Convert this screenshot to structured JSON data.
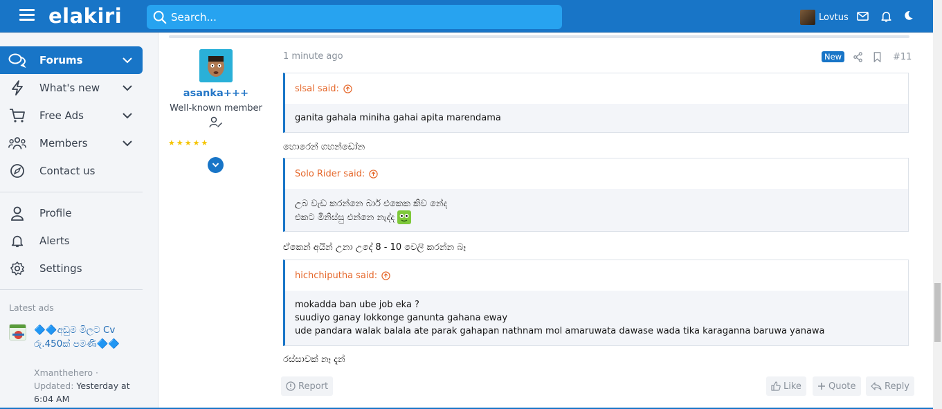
{
  "header": {
    "logo": "elakiri",
    "search_placeholder": "Search...",
    "username": "Lovtus",
    "brand_color": "#1875c7"
  },
  "sidebar": {
    "items": [
      {
        "label": "Forums",
        "icon": "chat-bubbles-icon",
        "active": true
      },
      {
        "label": "What's new",
        "icon": "lightning-icon"
      },
      {
        "label": "Free Ads",
        "icon": "cart-icon"
      },
      {
        "label": "Members",
        "icon": "members-icon"
      },
      {
        "label": "Contact us",
        "icon": "contact-icon"
      },
      {
        "label": "Profile",
        "icon": "profile-icon"
      },
      {
        "label": "Alerts",
        "icon": "bell-icon"
      },
      {
        "label": "Settings",
        "icon": "gear-icon"
      }
    ],
    "latest_ads_title": "Latest ads",
    "ad": {
      "title": "🔷🔷අඩුම මිලට Cv රු.450ක් පමණි🔷🔷",
      "author": "Xmanthehero",
      "updated_label": "Updated:",
      "updated_value": "Yesterday at 6:04 AM"
    }
  },
  "post": {
    "author": "asanka+++",
    "user_title": "Well-known member",
    "time": "1 minute ago",
    "badge": "New",
    "number": "#11",
    "quotes": [
      {
        "author": "slsal said:",
        "lines": [
          "ganita gahala miniha gahai apita marendama"
        ]
      },
      {
        "author": "Solo Rider said:",
        "lines": [
          "උබ වැඩ කරන්නෙ බාර් එකෙක කිව නේද",
          "එකට මිනිස්සු එන්නෙ නැද්ද"
        ]
      },
      {
        "author": "hichchiputha said:",
        "lines": [
          "mokadda ban ube job eka ?",
          "suudiyo ganay lokkonge ganunta gahana eway",
          "ude pandara walak balala ate parak gahapan nathnam mol amaruwata dawase wada tika karaganna baruwa yanawa"
        ]
      }
    ],
    "replies": [
      "හොරෙන් ගහන්ඩෝන",
      "ඒකෙන් අයින් උනා උදේ 8 - 10 වෙලි කරන්න බෑ",
      "රස්සාවක් නෑ දැන්"
    ],
    "actions": {
      "report": "Report",
      "like": "Like",
      "quote": "Quote",
      "reply": "Reply"
    }
  }
}
